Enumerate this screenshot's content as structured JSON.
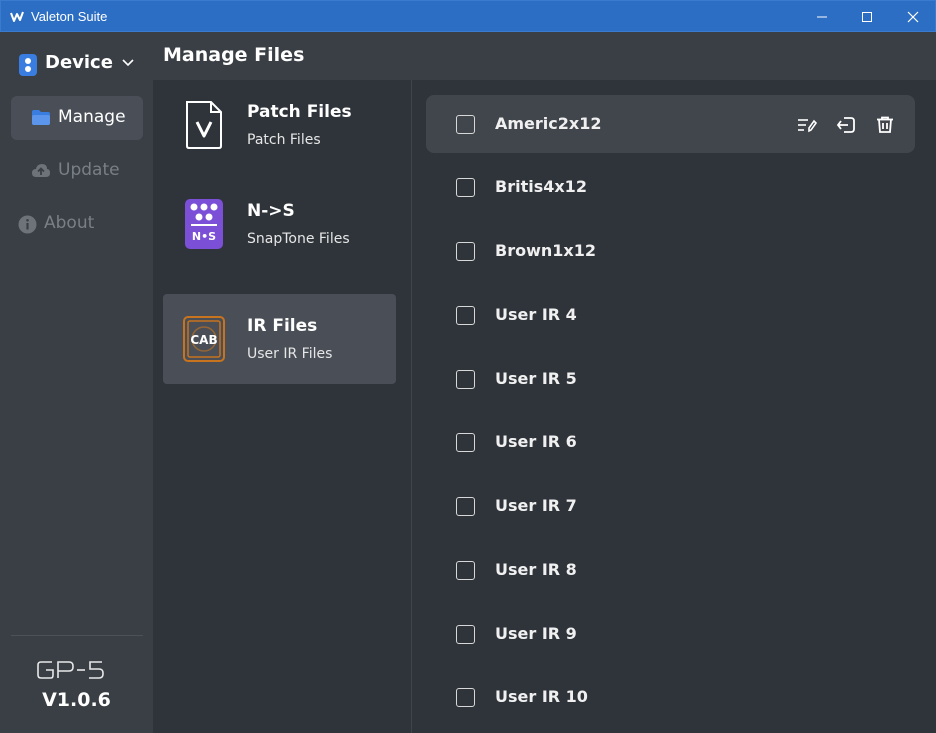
{
  "window": {
    "title": "Valeton Suite",
    "controls": [
      "minimize-icon",
      "maximize-icon",
      "close-icon"
    ]
  },
  "sidebar": {
    "device_label": "Device",
    "nav": [
      {
        "label": "Manage",
        "icon": "folder-icon",
        "active": true
      },
      {
        "label": "Update",
        "icon": "upload-cloud-icon",
        "active": false
      },
      {
        "label": "About",
        "icon": "info-icon",
        "active": false
      }
    ],
    "model_logo": "GP-5",
    "version": "V1.0.6"
  },
  "header": {
    "title": "Manage Files"
  },
  "categories": [
    {
      "title": "Patch Files",
      "subtitle": "Patch Files",
      "icon": "patch-file-icon"
    },
    {
      "title": "N->S",
      "subtitle": "SnapTone Files",
      "icon": "snaptone-pedal-icon",
      "icon_text": "N•S"
    },
    {
      "title": "IR Files",
      "subtitle": "User IR Files",
      "icon": "cab-icon",
      "icon_text": "CAB",
      "active": true
    }
  ],
  "files": [
    {
      "name": "Americ2x12",
      "hover": true
    },
    {
      "name": "Britis4x12"
    },
    {
      "name": "Brown1x12"
    },
    {
      "name": "User IR 4"
    },
    {
      "name": "User IR 5"
    },
    {
      "name": "User IR 6"
    },
    {
      "name": "User IR 7"
    },
    {
      "name": "User IR 8"
    },
    {
      "name": "User IR 9"
    },
    {
      "name": "User IR 10"
    }
  ],
  "row_actions": [
    "rename-icon",
    "export-icon",
    "delete-icon"
  ],
  "colors": {
    "titlebar": "#2c6ec3",
    "sidebar": "#3a3f45",
    "content": "#2f343a",
    "active_item": "#4a4f57",
    "accent_blue": "#3a7de0",
    "snaptone_purple": "#7b4fd6",
    "cab_orange": "#c8741e"
  }
}
